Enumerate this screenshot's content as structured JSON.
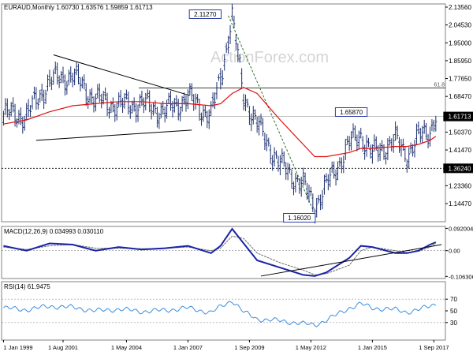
{
  "header": {
    "symbol_line": "EURAUD,Monthly  1.60730 1.63576 1.59859 1.61713",
    "watermark": "ActionForex.com"
  },
  "colors": {
    "background": "#ffffff",
    "price_bars": "#1c2f6e",
    "moving_average": "#e01010",
    "trendline": "#000000",
    "fib_dash": "#2a7a2a",
    "macd_line": "#1a23a6",
    "signal_line": "#6e6e6e",
    "rsi_line": "#3b8fe0",
    "grid": "#cccccc",
    "label_box": "#2a3aa8",
    "last_price_box": "#000000"
  },
  "chart_data": [
    {
      "type": "line",
      "title": "EURAUD,Monthly",
      "header_values": {
        "open": 1.6073,
        "high": 1.63576,
        "low": 1.59859,
        "close": 1.61713
      },
      "style": "bars",
      "x": [
        "1999-01",
        "2000-01",
        "2001-01",
        "2002-01",
        "2003-01",
        "2004-01",
        "2005-01",
        "2006-01",
        "2007-01",
        "2008-01",
        "2008-06",
        "2008-12",
        "2009-06",
        "2010-01",
        "2011-01",
        "2012-01",
        "2012-07",
        "2013-01",
        "2014-01",
        "2014-07",
        "2015-01",
        "2016-01",
        "2016-07",
        "2017-01",
        "2017-07",
        "2017-10"
      ],
      "series": [
        {
          "name": "EURAUD",
          "values": [
            1.63,
            1.62,
            1.79,
            1.82,
            1.7,
            1.67,
            1.68,
            1.64,
            1.71,
            1.62,
            1.8,
            2.11,
            1.72,
            1.58,
            1.38,
            1.28,
            1.18,
            1.27,
            1.48,
            1.53,
            1.43,
            1.5,
            1.43,
            1.51,
            1.55,
            1.62
          ]
        },
        {
          "name": "MA",
          "values": [
            1.58,
            1.6,
            1.64,
            1.67,
            1.68,
            1.69,
            1.69,
            1.68,
            1.68,
            1.67,
            1.68,
            1.73,
            1.76,
            1.73,
            1.6,
            1.48,
            1.42,
            1.42,
            1.44,
            1.46,
            1.46,
            1.47,
            1.47,
            1.48,
            1.5,
            1.52
          ]
        }
      ],
      "y_ticks": [
        "2.13560",
        "2.04530",
        "1.95000",
        "1.85950",
        "1.77650",
        "1.68470",
        "1.59560",
        "1.50370",
        "1.41470",
        "1.32290",
        "1.23360",
        "1.14470"
      ],
      "ylim": [
        1.1,
        2.17
      ],
      "x_ticks": [
        "1 Jan 1999",
        "1 Aug 2001",
        "1 May 2004",
        "1 Jan 2007",
        "1 Sep 2009",
        "1 May 2012",
        "1 Jan 2015",
        "1 Sep 2017"
      ],
      "annotations": {
        "high_label": "2.11270",
        "low_label": "1.16020",
        "swing_label": "1.65870",
        "support_label": "1.36240",
        "last_price": "1.61713",
        "fib_label": "61.8"
      },
      "levels": {
        "fib_618": 1.7565,
        "support": 1.3624,
        "last": 1.61713
      },
      "grid": false
    },
    {
      "type": "line",
      "title": "MACD(12,26,9) 0.034993 0.030110",
      "x": [
        "1999-01",
        "2000-01",
        "2001-01",
        "2002-01",
        "2003-01",
        "2004-01",
        "2005-01",
        "2006-01",
        "2007-01",
        "2008-01",
        "2008-06",
        "2008-12",
        "2009-06",
        "2010-01",
        "2011-01",
        "2012-01",
        "2012-07",
        "2013-01",
        "2014-01",
        "2014-07",
        "2015-01",
        "2016-01",
        "2016-07",
        "2017-01",
        "2017-07",
        "2017-10"
      ],
      "series": [
        {
          "name": "MACD",
          "values": [
            0.02,
            0.0,
            0.03,
            0.025,
            0.0,
            0.015,
            0.005,
            0.01,
            0.02,
            -0.01,
            0.02,
            0.09,
            0.03,
            -0.04,
            -0.07,
            -0.1,
            -0.105,
            -0.09,
            -0.03,
            0.02,
            0.015,
            -0.01,
            -0.01,
            0.0,
            0.025,
            0.035
          ]
        },
        {
          "name": "Signal",
          "values": [
            0.015,
            0.005,
            0.02,
            0.025,
            0.01,
            0.01,
            0.008,
            0.01,
            0.015,
            0.0,
            0.01,
            0.06,
            0.05,
            -0.01,
            -0.05,
            -0.08,
            -0.1,
            -0.095,
            -0.06,
            0.0,
            0.015,
            0.0,
            -0.008,
            -0.003,
            0.015,
            0.03
          ]
        }
      ],
      "y_ticks": [
        "0.092004",
        "0.00",
        "-0.106306"
      ],
      "ylim": [
        -0.115,
        0.1
      ],
      "grid": false
    },
    {
      "type": "line",
      "title": "RSI(14) 61.9475",
      "x": [
        "1999-01",
        "2000-01",
        "2001-01",
        "2002-01",
        "2003-01",
        "2004-01",
        "2005-01",
        "2006-01",
        "2007-01",
        "2008-01",
        "2008-06",
        "2008-12",
        "2009-06",
        "2010-01",
        "2011-01",
        "2012-01",
        "2012-07",
        "2013-01",
        "2014-01",
        "2014-07",
        "2015-01",
        "2016-01",
        "2016-07",
        "2017-01",
        "2017-07",
        "2017-10"
      ],
      "series": [
        {
          "name": "RSI",
          "values": [
            55,
            52,
            58,
            56,
            50,
            53,
            49,
            51,
            55,
            47,
            57,
            68,
            48,
            36,
            33,
            28,
            26,
            34,
            55,
            62,
            55,
            52,
            48,
            52,
            58,
            62
          ]
        }
      ],
      "y_ticks": [
        "70",
        "50",
        "30"
      ],
      "ylim": [
        0,
        100
      ],
      "grid": false
    }
  ]
}
